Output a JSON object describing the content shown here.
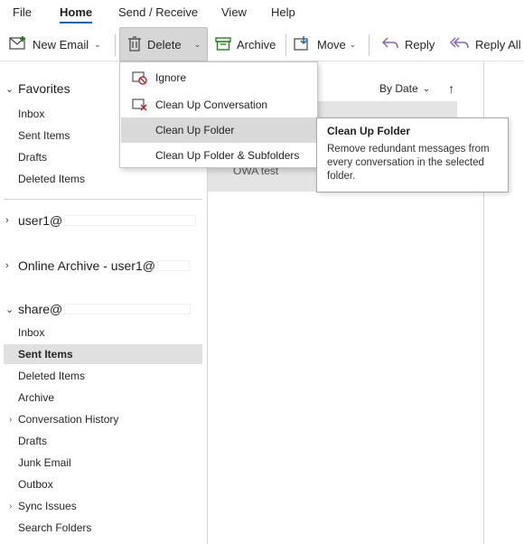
{
  "ribbon": {
    "tabs": [
      {
        "label": "File"
      },
      {
        "label": "Home"
      },
      {
        "label": "Send / Receive"
      },
      {
        "label": "View"
      },
      {
        "label": "Help"
      }
    ]
  },
  "toolbar": {
    "new_email": "New Email",
    "delete": "Delete",
    "archive": "Archive",
    "move": "Move",
    "reply": "Reply",
    "reply_all": "Reply All"
  },
  "delete_menu": {
    "items": [
      {
        "label": "Ignore"
      },
      {
        "label": "Clean Up Conversation"
      },
      {
        "label": "Clean Up Folder"
      },
      {
        "label": "Clean Up Folder & Subfolders"
      }
    ]
  },
  "tooltip": {
    "title": "Clean Up Folder",
    "body": "Remove redundant messages from every conversation in the selected folder."
  },
  "folders": {
    "favorites": {
      "title": "Favorites",
      "items": [
        "Inbox",
        "Sent Items",
        "Drafts",
        "Deleted Items"
      ]
    },
    "user1": "user1@",
    "online_archive": "Online Archive - user1@",
    "share": {
      "title": "share@",
      "items": [
        "Inbox",
        "Sent Items",
        "Deleted Items",
        "Archive",
        "Conversation History",
        "Drafts",
        "Junk Email",
        "Outbox",
        "Sync Issues",
        "Search Folders"
      ]
    }
  },
  "message_list": {
    "sort_label": "By Date",
    "visible_subject": "OWA test"
  },
  "colors": {
    "accent": "#0f6cbd",
    "selected_bg": "#e0e0e0",
    "menu_hover": "#d9d9d9"
  }
}
